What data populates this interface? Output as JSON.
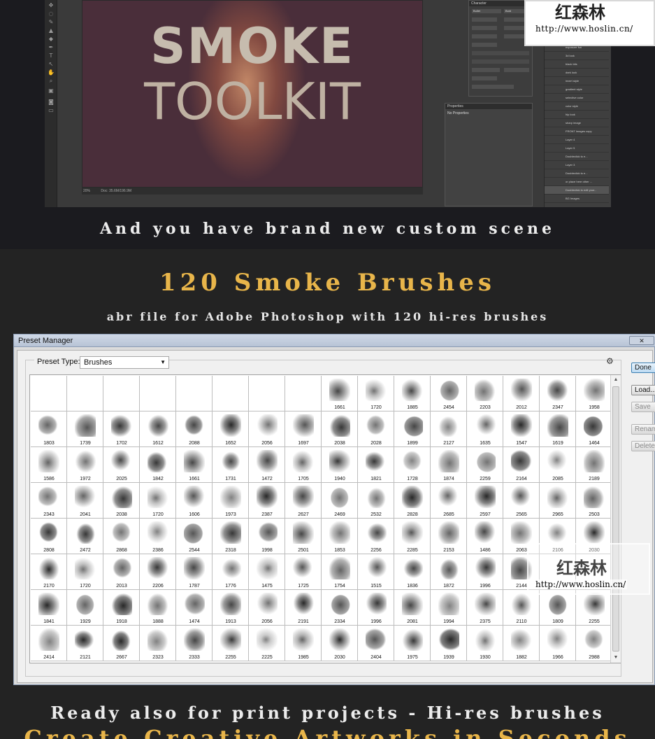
{
  "top": {
    "artwork": {
      "line1": "SMOKE",
      "line2": "TOOLKIT"
    },
    "status": {
      "zoom": "20%",
      "doc": "Doc: 35.6M/196.9M"
    },
    "character_panel": {
      "title": "Character",
      "font": "Bullet",
      "style": "Bold"
    },
    "properties_panel": {
      "title": "Properties",
      "subtitle": "No Properties"
    },
    "layers": [
      "soft",
      "folder image",
      "Foggy",
      "Amber",
      "exposure fun",
      "3d look",
      "black bits",
      "dark look",
      "invert style",
      "gradient style",
      "selective color",
      "color style",
      "hip look",
      "sharp image",
      "FRONT Images copy",
      "Layer 4",
      "Layer 5",
      "Doubleclick to e...",
      "Layer 3",
      "Doubleclick to e...",
      "or place here other ...",
      "Doubleclick to edit your...",
      "BG Images"
    ],
    "watermark": {
      "cn": "红森林",
      "url": "http://www.hoslin.cn/"
    },
    "caption": "And you have brand new custom scene"
  },
  "brushes": {
    "heading": "120 Smoke Brushes",
    "subheading": "abr file for Adobe Photoshop with 120 hi-res brushes"
  },
  "preset_manager": {
    "title": "Preset Manager",
    "preset_type_label": "Preset Type:",
    "preset_type_value": "Brushes",
    "buttons": {
      "done": "Done",
      "load": "Load...",
      "save": "Save Set...",
      "rename": "Rename...",
      "delete": "Delete"
    },
    "rows": [
      [
        "",
        "",
        "",
        "",
        "",
        "",
        "",
        "",
        "1661",
        "1720",
        "1885",
        "2454",
        "2203",
        "2012",
        "2347",
        "1958"
      ],
      [
        "1803",
        "1739",
        "1702",
        "1612",
        "2088",
        "1652",
        "2056",
        "1697",
        "2038",
        "2028",
        "1899",
        "2127",
        "1635",
        "1547",
        "1619",
        "1464"
      ],
      [
        "1586",
        "1972",
        "2025",
        "1842",
        "1661",
        "1731",
        "1472",
        "1705",
        "1940",
        "1821",
        "1728",
        "1874",
        "2259",
        "2164",
        "2085",
        "2189"
      ],
      [
        "2343",
        "2041",
        "2038",
        "1720",
        "1606",
        "1973",
        "2387",
        "2627",
        "2469",
        "2532",
        "2828",
        "2685",
        "2597",
        "2565",
        "2965",
        "2503"
      ],
      [
        "2808",
        "2472",
        "2868",
        "2386",
        "2544",
        "2318",
        "1998",
        "2501",
        "1853",
        "2256",
        "2285",
        "2153",
        "1486",
        "2063",
        "2106",
        "2030"
      ],
      [
        "2170",
        "1720",
        "2013",
        "2206",
        "1787",
        "1776",
        "1475",
        "1725",
        "1754",
        "1515",
        "1836",
        "1872",
        "1996",
        "2144",
        "",
        ""
      ],
      [
        "1841",
        "1929",
        "1918",
        "1888",
        "1474",
        "1913",
        "2056",
        "2191",
        "2334",
        "1996",
        "2081",
        "1994",
        "2375",
        "2110",
        "1809",
        "2255"
      ],
      [
        "2414",
        "2121",
        "2667",
        "2323",
        "2333",
        "2255",
        "2225",
        "1985",
        "2030",
        "2404",
        "1975",
        "1939",
        "1930",
        "1882",
        "1966",
        "2988"
      ]
    ]
  },
  "watermark_mid": {
    "cn": "红森林",
    "url": "http://www.hoslin.cn/"
  },
  "footer": {
    "caption1": "Ready also for print projects - Hi-res brushes",
    "caption2": "Create Creative Artworks in Seconds"
  }
}
